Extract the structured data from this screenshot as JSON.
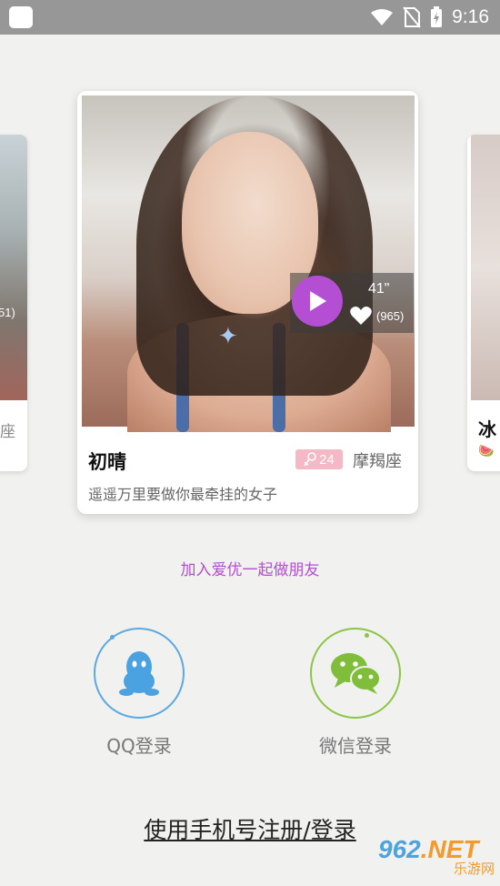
{
  "status_bar": {
    "time": "9:16",
    "icons": [
      "app-notification-icon",
      "wifi-icon",
      "no-sim-icon",
      "battery-charging-icon"
    ]
  },
  "left_card": {
    "partial_count": "51)",
    "partial_zodiac": "座"
  },
  "right_card": {
    "partial_name": "冰",
    "emoji": "🍉"
  },
  "profile": {
    "name": "初晴",
    "age": "24",
    "zodiac": "摩羯座",
    "bio": "遥遥万里要做你最牵挂的女子",
    "video_duration": "41\"",
    "likes": "(965)",
    "colors": {
      "play": "#b44fd3",
      "age_badge": "#f4b8c6"
    }
  },
  "tagline": "加入爱优一起做朋友",
  "login": {
    "qq_label": "QQ登录",
    "wechat_label": "微信登录",
    "phone_label": "使用手机号注册/登录",
    "colors": {
      "qq": "#5aa9e0",
      "wechat": "#8bc546"
    }
  },
  "watermark": {
    "number": "962",
    "suffix": ".NET",
    "subtitle": "乐游网"
  }
}
